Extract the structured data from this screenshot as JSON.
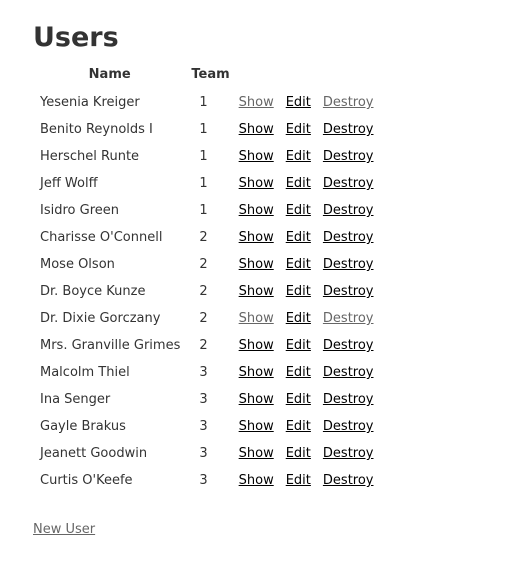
{
  "page": {
    "title": "Users"
  },
  "table": {
    "headers": {
      "name": "Name",
      "team": "Team"
    },
    "action_labels": {
      "show": "Show",
      "edit": "Edit",
      "destroy": "Destroy"
    },
    "rows": [
      {
        "name": "Yesenia Kreiger",
        "team": "1",
        "visited": true
      },
      {
        "name": "Benito Reynolds I",
        "team": "1",
        "visited": false
      },
      {
        "name": "Herschel Runte",
        "team": "1",
        "visited": false
      },
      {
        "name": "Jeff Wolff",
        "team": "1",
        "visited": false
      },
      {
        "name": "Isidro Green",
        "team": "1",
        "visited": false
      },
      {
        "name": "Charisse O'Connell",
        "team": "2",
        "visited": false
      },
      {
        "name": "Mose Olson",
        "team": "2",
        "visited": false
      },
      {
        "name": "Dr. Boyce Kunze",
        "team": "2",
        "visited": false
      },
      {
        "name": "Dr. Dixie Gorczany",
        "team": "2",
        "visited": true
      },
      {
        "name": "Mrs. Granville Grimes",
        "team": "2",
        "visited": false
      },
      {
        "name": "Malcolm Thiel",
        "team": "3",
        "visited": false
      },
      {
        "name": "Ina Senger",
        "team": "3",
        "visited": false
      },
      {
        "name": "Gayle Brakus",
        "team": "3",
        "visited": false
      },
      {
        "name": "Jeanett Goodwin",
        "team": "3",
        "visited": false
      },
      {
        "name": "Curtis O'Keefe",
        "team": "3",
        "visited": false
      }
    ]
  },
  "footer": {
    "new_user_label": "New User"
  },
  "colors": {
    "text": "#333333",
    "link": "#000000",
    "link_visited": "#666666",
    "background": "#ffffff"
  }
}
